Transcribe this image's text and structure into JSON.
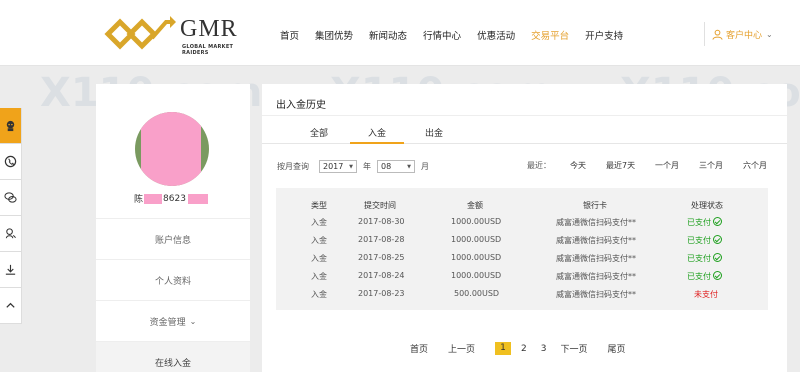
{
  "header": {
    "logo_text": "GMR",
    "logo_subtext": "GLOBAL MARKET RAIDERS",
    "nav": [
      "首页",
      "集团优势",
      "新闻动态",
      "行情中心",
      "优惠活动",
      "交易平台",
      "开户支持"
    ],
    "active_nav": "交易平台",
    "account_label": "客户中心"
  },
  "sidebar": {
    "username_prefix": "陈",
    "username_visible": "8623",
    "menu": [
      "账户信息",
      "个人资料",
      "资金管理",
      "在线入金"
    ]
  },
  "panel": {
    "title": "出入金历史",
    "tabs": [
      "全部",
      "入金",
      "出金"
    ],
    "active_tab": "入金",
    "filter": {
      "label": "按月查询",
      "year": "2017",
      "year_unit": "年",
      "month": "08",
      "month_unit": "月"
    },
    "recent_label": "最近：",
    "quick_ranges": [
      "今天",
      "最近7天",
      "一个月",
      "三个月",
      "六个月"
    ],
    "table": {
      "headers": [
        "类型",
        "提交时间",
        "金额",
        "银行卡",
        "处理状态"
      ],
      "rows": [
        {
          "type": "入金",
          "date": "2017-08-30",
          "amount": "1000.00USD",
          "bank": "威富通微信扫码支付**",
          "status": "已支付",
          "paid": true
        },
        {
          "type": "入金",
          "date": "2017-08-28",
          "amount": "1000.00USD",
          "bank": "威富通微信扫码支付**",
          "status": "已支付",
          "paid": true
        },
        {
          "type": "入金",
          "date": "2017-08-25",
          "amount": "1000.00USD",
          "bank": "威富通微信扫码支付**",
          "status": "已支付",
          "paid": true
        },
        {
          "type": "入金",
          "date": "2017-08-24",
          "amount": "1000.00USD",
          "bank": "威富通微信扫码支付**",
          "status": "已支付",
          "paid": true
        },
        {
          "type": "入金",
          "date": "2017-08-23",
          "amount": "500.00USD",
          "bank": "威富通微信扫码支付**",
          "status": "未支付",
          "paid": false
        }
      ]
    },
    "pager": {
      "first": "首页",
      "prev": "上一页",
      "pages": [
        "1",
        "2",
        "3"
      ],
      "current": "1",
      "next": "下一页",
      "last": "尾页"
    }
  },
  "watermark": "X110.com",
  "colors": {
    "accent": "#f0a31a",
    "paid": "#20a020",
    "unpaid": "#e02020",
    "masked": "#f9a0c9"
  }
}
